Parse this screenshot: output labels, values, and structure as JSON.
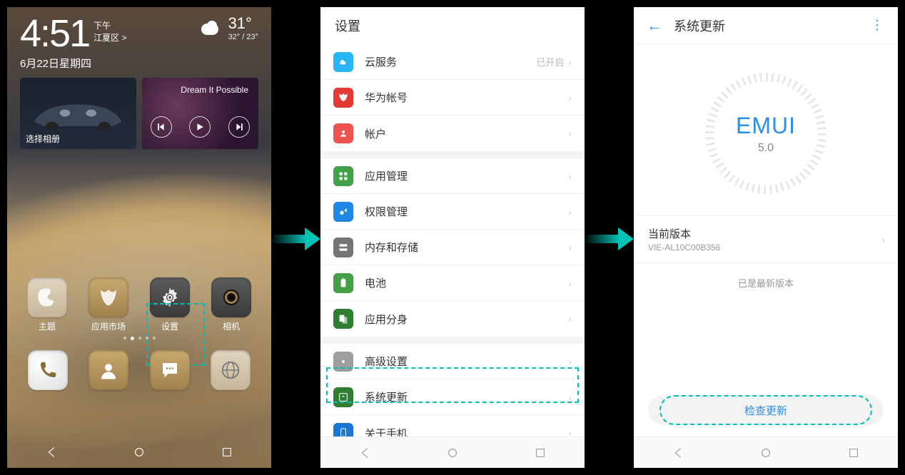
{
  "home": {
    "time": "4:51",
    "ampm": "下午",
    "location": "江夏区",
    "temp": "31°",
    "temp_range": "32° / 23°",
    "date": "6月22日星期四",
    "gallery_label": "选择相册",
    "music_title": "Dream It Possible",
    "apps": {
      "theme": "主题",
      "market": "应用市场",
      "settings": "设置",
      "camera": "相机"
    }
  },
  "settings": {
    "title": "设置",
    "groups": [
      [
        {
          "icon": "cloud",
          "color": "#29B6F6",
          "label": "云服务",
          "value": "已开启"
        },
        {
          "icon": "huawei",
          "color": "#E53935",
          "label": "华为帐号"
        },
        {
          "icon": "account",
          "color": "#EF5350",
          "label": "帐户"
        }
      ],
      [
        {
          "icon": "apps",
          "color": "#43A047",
          "label": "应用管理"
        },
        {
          "icon": "perm",
          "color": "#1E88E5",
          "label": "权限管理"
        },
        {
          "icon": "storage",
          "color": "#757575",
          "label": "内存和存储"
        },
        {
          "icon": "battery",
          "color": "#43A047",
          "label": "电池"
        },
        {
          "icon": "clone",
          "color": "#2E7D32",
          "label": "应用分身"
        }
      ],
      [
        {
          "icon": "advanced",
          "color": "#9E9E9E",
          "label": "高级设置"
        },
        {
          "icon": "update",
          "color": "#2E7D32",
          "label": "系统更新",
          "highlight": true
        },
        {
          "icon": "about",
          "color": "#1976D2",
          "label": "关于手机"
        }
      ]
    ]
  },
  "sysupdate": {
    "title": "系统更新",
    "emui_label": "EMUI",
    "emui_version": "5.0",
    "current_version_label": "当前版本",
    "current_version_value": "VIE-AL10C00B356",
    "latest_msg": "已是最新版本",
    "check_button": "检查更新"
  }
}
